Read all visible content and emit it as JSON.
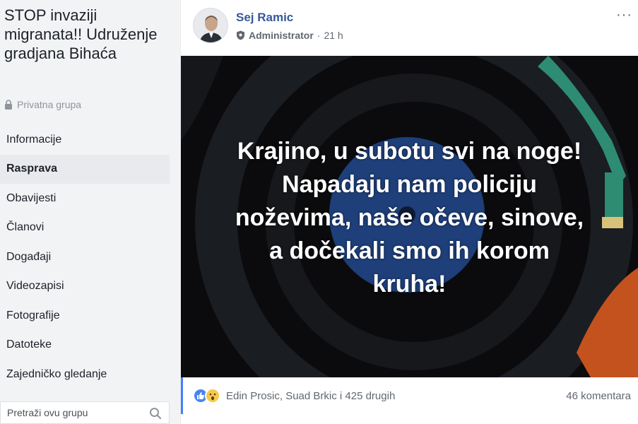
{
  "group": {
    "title": "STOP invaziji migranata!! Udruženje gradjana Bihaća",
    "privacy": "Privatna grupa"
  },
  "nav": {
    "items": [
      {
        "label": "Informacije"
      },
      {
        "label": "Rasprava",
        "active": true
      },
      {
        "label": "Obavijesti"
      },
      {
        "label": "Članovi"
      },
      {
        "label": "Događaji"
      },
      {
        "label": "Videozapisi"
      },
      {
        "label": "Fotografije"
      },
      {
        "label": "Datoteke"
      },
      {
        "label": "Zajedničko gledanje"
      }
    ]
  },
  "search": {
    "placeholder": "Pretraži ovu grupu"
  },
  "post": {
    "author": "Sej Ramic",
    "role": "Administrator",
    "separator": "·",
    "time": "21 h",
    "more": "···",
    "image_text": [
      "Krajino, u subotu svi na noge!",
      "Napadaju nam policiju",
      "noževima, naše očeve, sinove,",
      "a dočekali smo ih korom",
      "kruha!"
    ],
    "reactions": {
      "names": "Edin Prosic, Suad Brkic i 425 drugih",
      "comments": "46 komentara",
      "icons": [
        "like-icon",
        "wow-icon"
      ]
    }
  },
  "colors": {
    "link": "#365899",
    "sidebar_bg": "#f2f3f5",
    "image_bg": "#0b0b0d",
    "accent": "#4080ff"
  }
}
